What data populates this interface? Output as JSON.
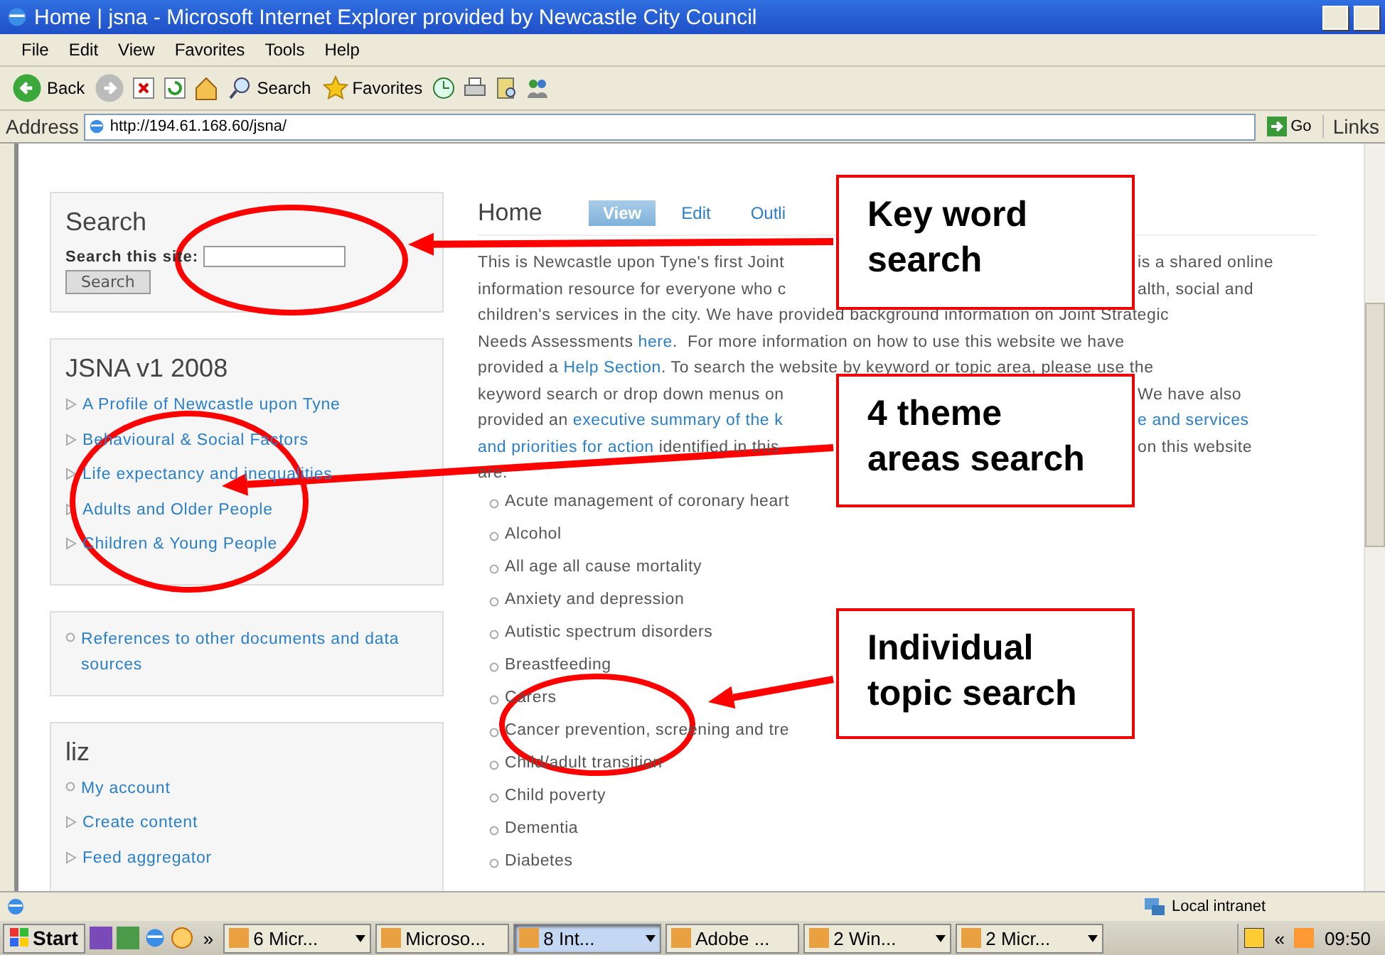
{
  "window": {
    "title": "Home | jsna - Microsoft Internet Explorer provided by Newcastle City Council"
  },
  "menu": [
    "File",
    "Edit",
    "View",
    "Favorites",
    "Tools",
    "Help"
  ],
  "toolbar": [
    {
      "kind": "back",
      "label": "Back"
    },
    {
      "kind": "forward"
    },
    {
      "kind": "stop"
    },
    {
      "kind": "refresh"
    },
    {
      "kind": "home"
    },
    {
      "kind": "search",
      "label": "Search"
    },
    {
      "kind": "favorites",
      "label": "Favorites"
    },
    {
      "kind": "history"
    },
    {
      "kind": "print"
    },
    {
      "kind": "research"
    },
    {
      "kind": "messenger"
    }
  ],
  "address": {
    "label": "Address",
    "value": "http://194.61.168.60/jsna/",
    "go": "Go",
    "links": "Links"
  },
  "sidebar": {
    "search": {
      "title": "Search",
      "label": "Search this site:",
      "button": "Search"
    },
    "blocks": [
      {
        "title": "JSNA v1 2008",
        "items": [
          {
            "text": "A Profile of Newcastle upon Tyne",
            "kind": "triangle"
          },
          {
            "text": "Behavioural & Social Factors",
            "kind": "triangle"
          },
          {
            "text": "Life expectancy and inequalities",
            "kind": "triangle"
          },
          {
            "text": "Adults and Older People",
            "kind": "triangle"
          },
          {
            "text": "Children & Young People",
            "kind": "triangle"
          }
        ]
      },
      {
        "items": [
          {
            "text": "References to other documents and data sources",
            "kind": "circle"
          }
        ]
      },
      {
        "title": "liz",
        "items": [
          {
            "text": "My account",
            "kind": "circle"
          },
          {
            "text": "Create content",
            "kind": "triangle"
          },
          {
            "text": "Feed aggregator",
            "kind": "triangle"
          }
        ]
      }
    ]
  },
  "page": {
    "title": "Home",
    "tabs": [
      {
        "label": "View",
        "selected": true
      },
      {
        "label": "Edit",
        "selected": false
      },
      {
        "label": "Outli",
        "selected": false
      }
    ],
    "intro": [
      {
        "left": [
          {
            "text": "This is Newcastle upon Tyne's first Joint",
            "link": false
          }
        ],
        "right": [
          {
            "text": "is a shared online",
            "link": false
          }
        ]
      },
      {
        "left": [
          {
            "text": "information resource for everyone who c",
            "link": false
          }
        ],
        "right": [
          {
            "text": "alth, social and",
            "link": false
          }
        ]
      },
      {
        "left": [
          {
            "text": "children's services in the city. We have provided background information on Joint Strategic",
            "link": false
          }
        ]
      },
      {
        "left": [
          {
            "text": "Needs Assessments ",
            "link": false
          },
          {
            "text": "here",
            "link": true
          },
          {
            "text": ".  For more information on how to use this website we have",
            "link": false
          }
        ]
      },
      {
        "left": [
          {
            "text": "provided a ",
            "link": false
          },
          {
            "text": "Help Section",
            "link": true
          },
          {
            "text": ". To search the website by keyword or topic area, please use the",
            "link": false
          }
        ]
      },
      {
        "left": [
          {
            "text": "keyword search or drop down menus on",
            "link": false
          }
        ],
        "right": [
          {
            "text": "We have also",
            "link": false
          }
        ]
      },
      {
        "left": [
          {
            "text": "provided an ",
            "link": false
          },
          {
            "text": "executive summary of the k",
            "link": true
          }
        ],
        "right": [
          {
            "text": "e and services",
            "link": true
          }
        ]
      },
      {
        "left": [
          {
            "text": "and priorities for action",
            "link": true
          },
          {
            "text": " identified in this",
            "link": false
          }
        ],
        "right": [
          {
            "text": "on this website",
            "link": false
          }
        ]
      },
      {
        "left": [
          {
            "text": "are:",
            "link": false
          }
        ]
      }
    ],
    "topics": [
      "Acute management of coronary heart",
      "Alcohol",
      "All age all cause mortality",
      "Anxiety and depression",
      "Autistic spectrum disorders",
      "Breastfeeding",
      "Carers",
      "Cancer prevention, screening and tre",
      "Child/adult transition",
      "Child poverty",
      "Dementia",
      "Diabetes"
    ]
  },
  "annotations": [
    {
      "lines": [
        "Key word",
        "search"
      ]
    },
    {
      "lines": [
        "4 theme",
        "areas search"
      ]
    },
    {
      "lines": [
        "Individual",
        "topic search"
      ]
    }
  ],
  "status_bar": {
    "zone": "Local intranet"
  },
  "taskbar": {
    "start": "Start",
    "more": "»",
    "tasks": [
      {
        "label": "6 Micr...",
        "grouped": true,
        "selected": false
      },
      {
        "label": "Microso...",
        "grouped": false,
        "selected": false
      },
      {
        "label": "8 Int...",
        "grouped": true,
        "selected": true
      },
      {
        "label": "Adobe ...",
        "grouped": false,
        "selected": false
      },
      {
        "label": "2 Win...",
        "grouped": true,
        "selected": false
      },
      {
        "label": "2 Micr...",
        "grouped": true,
        "selected": false
      }
    ],
    "tray_more": "«",
    "clock": "09:50"
  }
}
